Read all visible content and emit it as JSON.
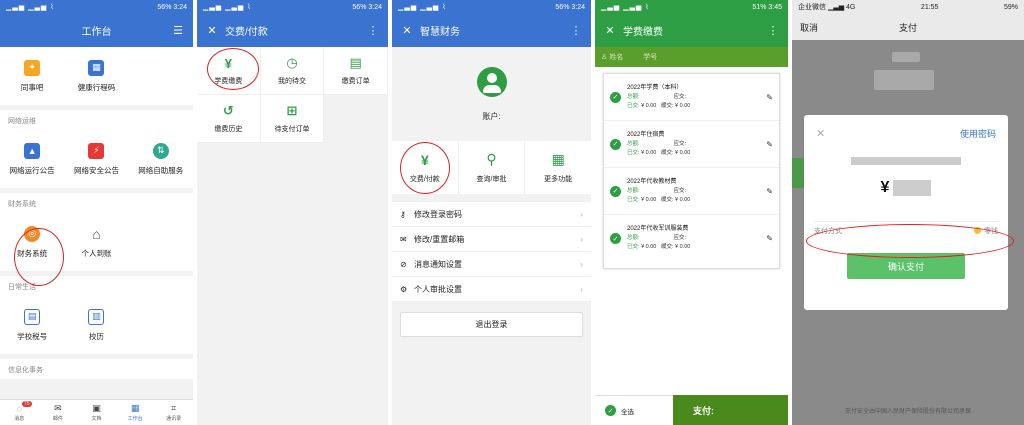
{
  "p1": {
    "status": {
      "signal": "▁▃▅ ▁▃▅ ⌇",
      "battery": "56%",
      "time": "3:24"
    },
    "title": "工作台",
    "top_items": [
      {
        "label": "同事吧",
        "color": "#f5a623",
        "icon": "✦"
      },
      {
        "label": "健康行程码",
        "color": "#3b73d1",
        "icon": "▦"
      }
    ],
    "sections": [
      {
        "title": "网络运维",
        "items": [
          {
            "label": "网络运行公告",
            "color": "#3b73d1",
            "icon": "▲"
          },
          {
            "label": "网络安全公告",
            "color": "#e53935",
            "icon": "⚡"
          },
          {
            "label": "网络自助服务",
            "color": "#2ea88f",
            "icon": "⇅"
          }
        ]
      },
      {
        "title": "财务系统",
        "items": [
          {
            "label": "财务系统",
            "color": "#f08a24",
            "icon": "◎"
          },
          {
            "label": "个人到账",
            "color": "#555555",
            "icon": "⌂"
          }
        ]
      },
      {
        "title": "日常生活",
        "items": [
          {
            "label": "学校税号",
            "color": "#3b73d1",
            "icon": "▤"
          },
          {
            "label": "校历",
            "color": "#3b73d1",
            "icon": "▥"
          }
        ]
      },
      {
        "title": "信息化事务",
        "items": []
      }
    ],
    "tabs": [
      {
        "label": "消息",
        "icon": "◌"
      },
      {
        "label": "邮件",
        "icon": "✉"
      },
      {
        "label": "文档",
        "icon": "▣"
      },
      {
        "label": "工作台",
        "icon": "▦"
      },
      {
        "label": "通讯录",
        "icon": "⌗"
      }
    ],
    "badge": "75"
  },
  "p2": {
    "status": {
      "signal": "▁▃▅ ▁▃▅ ⌇",
      "battery": "56%",
      "time": "3:24"
    },
    "title": "交费/付款",
    "items": [
      {
        "label": "学费缴费",
        "icon": "¥"
      },
      {
        "label": "我的待交",
        "icon": "◷"
      },
      {
        "label": "缴费订单",
        "icon": "▤"
      },
      {
        "label": "缴费历史",
        "icon": "↺"
      },
      {
        "label": "待支付订单",
        "icon": "⊞"
      }
    ]
  },
  "p3": {
    "status": {
      "signal": "▁▃▅ ▁▃▅ ⌇",
      "battery": "56%",
      "time": "3:24"
    },
    "title": "智慧财务",
    "account_label": "账户:",
    "actions": [
      {
        "label": "交费/付款",
        "icon": "¥"
      },
      {
        "label": "查询/审批",
        "icon": "⚲"
      },
      {
        "label": "更多功能",
        "icon": "▦"
      }
    ],
    "menu": [
      {
        "label": "修改登录密码",
        "icon": "🔑"
      },
      {
        "label": "修改/重置邮箱",
        "icon": "✉"
      },
      {
        "label": "消息通知设置",
        "icon": "⊘"
      },
      {
        "label": "个人审批设置",
        "icon": "⚙"
      }
    ],
    "logout": "退出登录"
  },
  "p4": {
    "status": {
      "signal": "▁▃▅ ▁▃▅ ⌇",
      "battery": "51%",
      "time": "3:45"
    },
    "title": "学费缴费",
    "sub_labels": [
      "姓名",
      "学号"
    ],
    "fees": [
      {
        "name": "2022年学费（本科）",
        "total_label": "总额:",
        "due_label": "应交:",
        "paid_label": "已交:",
        "paid": "¥ 0.00",
        "defer_label": "缓交:",
        "defer": "¥ 0.00"
      },
      {
        "name": "2022年住宿费",
        "total_label": "总额:",
        "due_label": "应交:",
        "paid_label": "已交:",
        "paid": "¥ 0.00",
        "defer_label": "缓交:",
        "defer": "¥ 0.00"
      },
      {
        "name": "2022年代收教材费",
        "total_label": "总额:",
        "due_label": "应交:",
        "paid_label": "已交:",
        "paid": "¥ 0.00",
        "defer_label": "缓交:",
        "defer": "¥ 0.00"
      },
      {
        "name": "2022年代收军训服装费",
        "total_label": "总额:",
        "due_label": "应交:",
        "paid_label": "已交:",
        "paid": "¥ 0.00",
        "defer_label": "缓交:",
        "defer": "¥ 0.00"
      }
    ],
    "select_all": "全选",
    "pay": "支付:"
  },
  "p5": {
    "status": {
      "carrier": "企业微信 ▁▃▅ 4G",
      "time": "21:55",
      "battery": "59%"
    },
    "cancel": "取消",
    "title": "支付",
    "use_password": "使用密码",
    "currency": "¥",
    "pay_method_label": "支付方式",
    "pay_method_value": "零钱",
    "confirm": "确认支付",
    "footer": "支付安全由中国人民财产保险股份有限公司承保"
  },
  "colors": {
    "blue": "#3b73d1",
    "green": "#2e9e44",
    "annotation_red": "#e02020"
  }
}
